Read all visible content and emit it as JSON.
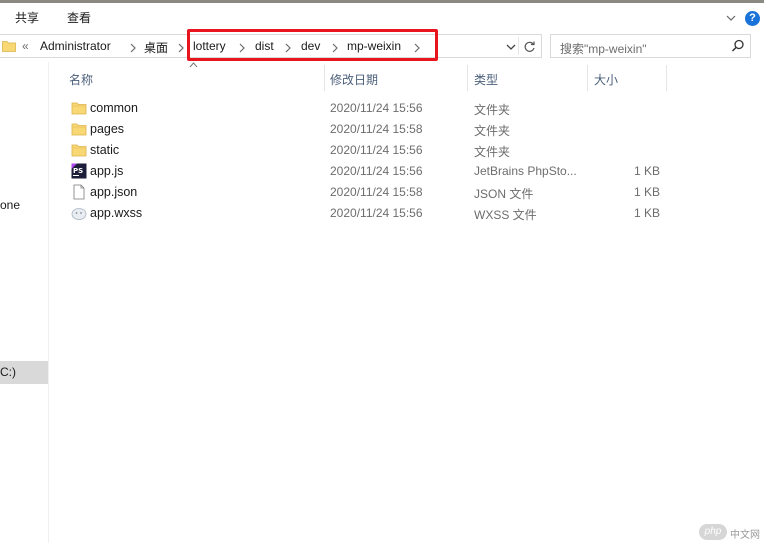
{
  "ribbon": {
    "tabs": [
      "共享",
      "查看"
    ]
  },
  "address": {
    "overflow": "«",
    "crumbs": [
      "Administrator",
      "桌面",
      "lottery",
      "dist",
      "dev",
      "mp-weixin"
    ]
  },
  "search": {
    "placeholder": "搜索\"mp-weixin\""
  },
  "nav": {
    "item_partial_1": "one",
    "item_partial_2": "C:)"
  },
  "columns": {
    "name": "名称",
    "date": "修改日期",
    "type": "类型",
    "size": "大小"
  },
  "files": [
    {
      "name": "common",
      "date": "2020/11/24 15:56",
      "type": "文件夹",
      "size": "",
      "icon": "folder-icon"
    },
    {
      "name": "pages",
      "date": "2020/11/24 15:58",
      "type": "文件夹",
      "size": "",
      "icon": "folder-icon"
    },
    {
      "name": "static",
      "date": "2020/11/24 15:56",
      "type": "文件夹",
      "size": "",
      "icon": "folder-icon"
    },
    {
      "name": "app.js",
      "date": "2020/11/24 15:56",
      "type": "JetBrains PhpSto...",
      "size": "1 KB",
      "icon": "phpstorm-file-icon"
    },
    {
      "name": "app.json",
      "date": "2020/11/24 15:58",
      "type": "JSON 文件",
      "size": "1 KB",
      "icon": "json-file-icon"
    },
    {
      "name": "app.wxss",
      "date": "2020/11/24 15:56",
      "type": "WXSS 文件",
      "size": "1 KB",
      "icon": "wxss-file-icon"
    }
  ],
  "watermark": {
    "logo": "php",
    "text": "中文网"
  },
  "colors": {
    "highlight": "#e8141e",
    "folder": "#f8d775",
    "help": "#1a73d9",
    "header_text": "#4c607a"
  }
}
